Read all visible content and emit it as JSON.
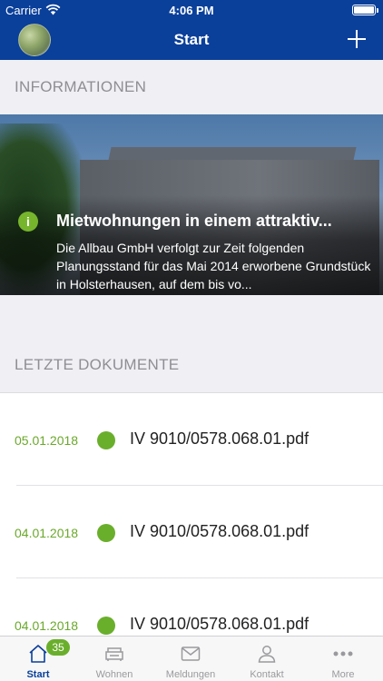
{
  "status_bar": {
    "carrier": "Carrier",
    "time": "4:06 PM"
  },
  "nav": {
    "title": "Start"
  },
  "sections": {
    "info_title": "INFORMATIONEN",
    "docs_title": "LETZTE DOKUMENTE"
  },
  "news": {
    "icon": "info-icon",
    "title": "Mietwohnungen in einem attraktiv...",
    "text": "Die Allbau GmbH verfolgt zur Zeit folgenden Planungsstand für das Mai 2014 erworbene Grundstück in Holsterhausen, auf dem bis vo..."
  },
  "documents": [
    {
      "date": "05.01.2018",
      "name": "IV 9010/0578.068.01.pdf"
    },
    {
      "date": "04.01.2018",
      "name": "IV 9010/0578.068.01.pdf"
    },
    {
      "date": "04.01.2018",
      "name": "IV 9010/0578.068.01.pdf"
    }
  ],
  "tabs": [
    {
      "label": "Start",
      "icon": "home-icon",
      "badge": "35",
      "active": true
    },
    {
      "label": "Wohnen",
      "icon": "sofa-icon"
    },
    {
      "label": "Meldungen",
      "icon": "mail-icon"
    },
    {
      "label": "Kontakt",
      "icon": "person-icon"
    },
    {
      "label": "More",
      "icon": "more-icon"
    }
  ],
  "colors": {
    "nav_bg": "#0a3f9a",
    "accent_green": "#6aaf2c"
  }
}
